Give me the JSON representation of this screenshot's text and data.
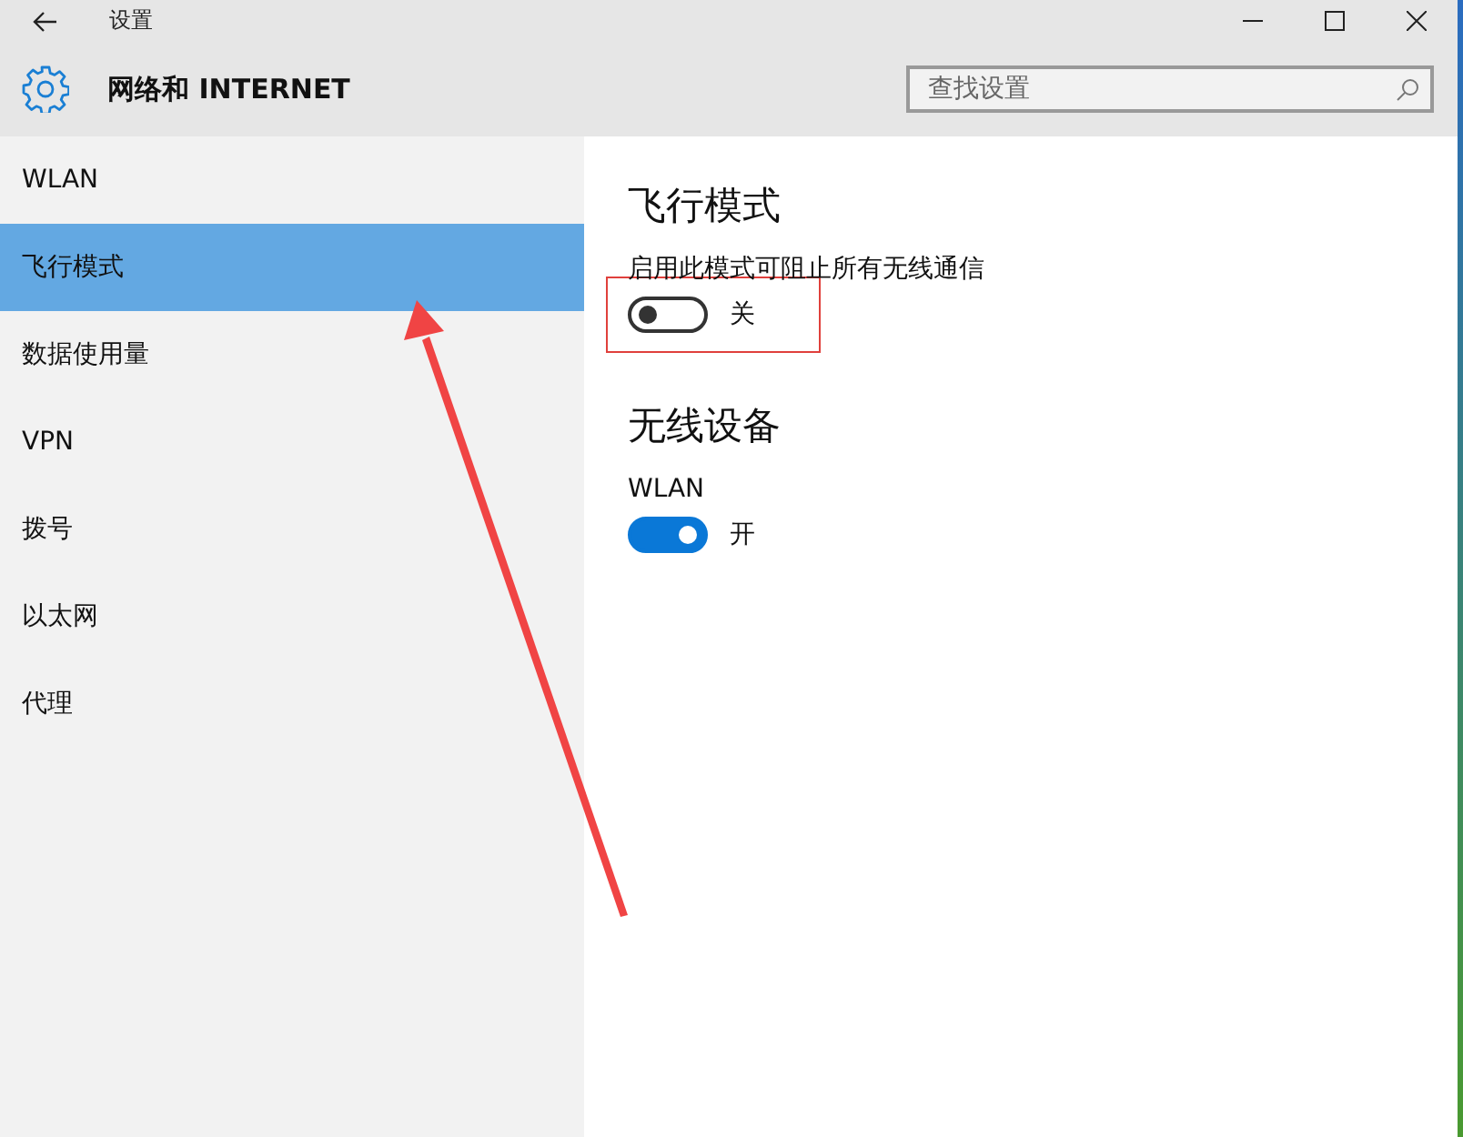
{
  "window": {
    "title": "设置"
  },
  "header": {
    "title": "网络和 INTERNET",
    "search": {
      "placeholder": "查找设置"
    }
  },
  "sidebar": {
    "items": [
      {
        "label": "WLAN",
        "selected": false
      },
      {
        "label": "飞行模式",
        "selected": true
      },
      {
        "label": "数据使用量",
        "selected": false
      },
      {
        "label": "VPN",
        "selected": false
      },
      {
        "label": "拨号",
        "selected": false
      },
      {
        "label": "以太网",
        "selected": false
      },
      {
        "label": "代理",
        "selected": false
      }
    ]
  },
  "sections": [
    {
      "heading": "飞行模式",
      "settings": [
        {
          "label": "启用此模式可阻止所有无线通信",
          "on": false,
          "state_text": "关",
          "highlighted": true
        }
      ]
    },
    {
      "heading": "无线设备",
      "settings": [
        {
          "label": "WLAN",
          "on": true,
          "state_text": "开",
          "highlighted": false
        }
      ]
    }
  ]
}
